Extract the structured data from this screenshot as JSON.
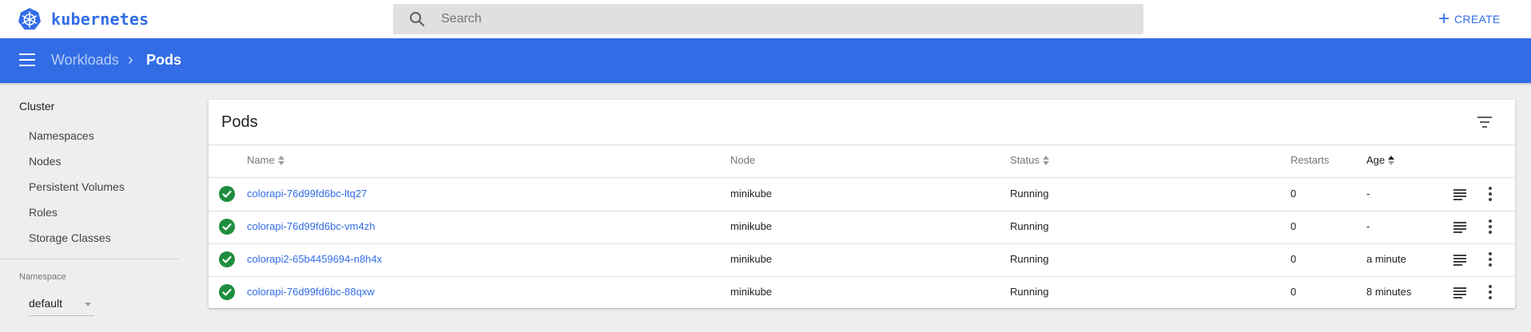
{
  "header": {
    "brand": "kubernetes",
    "search_placeholder": "Search",
    "create_label": "CREATE",
    "accent_color": "#326de6"
  },
  "toolbar": {
    "breadcrumb": [
      "Workloads",
      "Pods"
    ],
    "separator": "›"
  },
  "sidebar": {
    "section_title": "Cluster",
    "items": [
      "Namespaces",
      "Nodes",
      "Persistent Volumes",
      "Roles",
      "Storage Classes"
    ],
    "namespace_label": "Namespace",
    "namespace_value": "default"
  },
  "card": {
    "title": "Pods",
    "columns": {
      "name": "Name",
      "node": "Node",
      "status": "Status",
      "restarts": "Restarts",
      "age": "Age"
    },
    "rows": [
      {
        "name": "colorapi-76d99fd6bc-ltq27",
        "node": "minikube",
        "status": "Running",
        "restarts": "0",
        "age": "-"
      },
      {
        "name": "colorapi-76d99fd6bc-vm4zh",
        "node": "minikube",
        "status": "Running",
        "restarts": "0",
        "age": "-"
      },
      {
        "name": "colorapi2-65b4459694-n8h4x",
        "node": "minikube",
        "status": "Running",
        "restarts": "0",
        "age": "a minute"
      },
      {
        "name": "colorapi-76d99fd6bc-88qxw",
        "node": "minikube",
        "status": "Running",
        "restarts": "0",
        "age": "8 minutes"
      }
    ]
  },
  "icons": {
    "logo": "kubernetes-helm-icon",
    "search": "search-icon",
    "create": "plus-icon",
    "menu": "hamburger-menu-icon",
    "filter": "filter-icon",
    "status": "check-circle-icon",
    "logs": "logs-icon",
    "more": "more-vert-icon"
  },
  "colors": {
    "primary": "#326de6",
    "success": "#1e8e3e",
    "background": "#eeeeee"
  }
}
